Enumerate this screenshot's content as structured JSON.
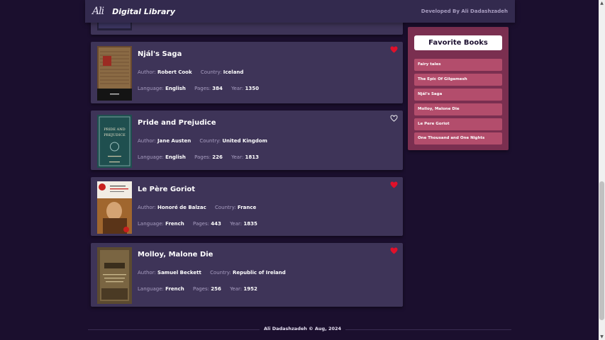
{
  "header": {
    "logo_text": "Ali",
    "site_title": "Digital Library",
    "credit": "Developed By Ali Dadashzadeh"
  },
  "labels": {
    "author": "Author:",
    "country": "Country:",
    "language": "Language:",
    "pages": "Pages:",
    "year": "Year:"
  },
  "books": [
    {
      "title": "Njál's Saga",
      "author": "Robert Cook",
      "country": "Iceland",
      "language": "English",
      "pages": "384",
      "year": "1350",
      "favorite": true
    },
    {
      "title": "Pride and Prejudice",
      "author": "Jane Austen",
      "country": "United Kingdom",
      "language": "English",
      "pages": "226",
      "year": "1813",
      "favorite": false
    },
    {
      "title": "Le Père Goriot",
      "author": "Honoré de Balzac",
      "country": "France",
      "language": "French",
      "pages": "443",
      "year": "1835",
      "favorite": true
    },
    {
      "title": "Molloy, Malone Die",
      "author": "Samuel Beckett",
      "country": "Republic of Ireland",
      "language": "French",
      "pages": "256",
      "year": "1952",
      "favorite": true
    }
  ],
  "favorites": {
    "title": "Favorite Books",
    "items": [
      "Fairy tales",
      "The Epic Of Gilgamesh",
      "Njál's Saga",
      "Molloy, Malone Die",
      "Le Pere Goriot",
      "One Thousand and One Nights"
    ]
  },
  "cover_texts": {
    "pride_title": "PRIDE AND PREJUDICE"
  },
  "footer": {
    "text": "Ali Dadashzadeh © Aug, 2024"
  },
  "colors": {
    "background": "#1b0f2e",
    "card": "#3e3458",
    "favorites_panel": "#7a2f50",
    "favorite_item": "#b34d6c",
    "heart_active": "#e0102a"
  }
}
